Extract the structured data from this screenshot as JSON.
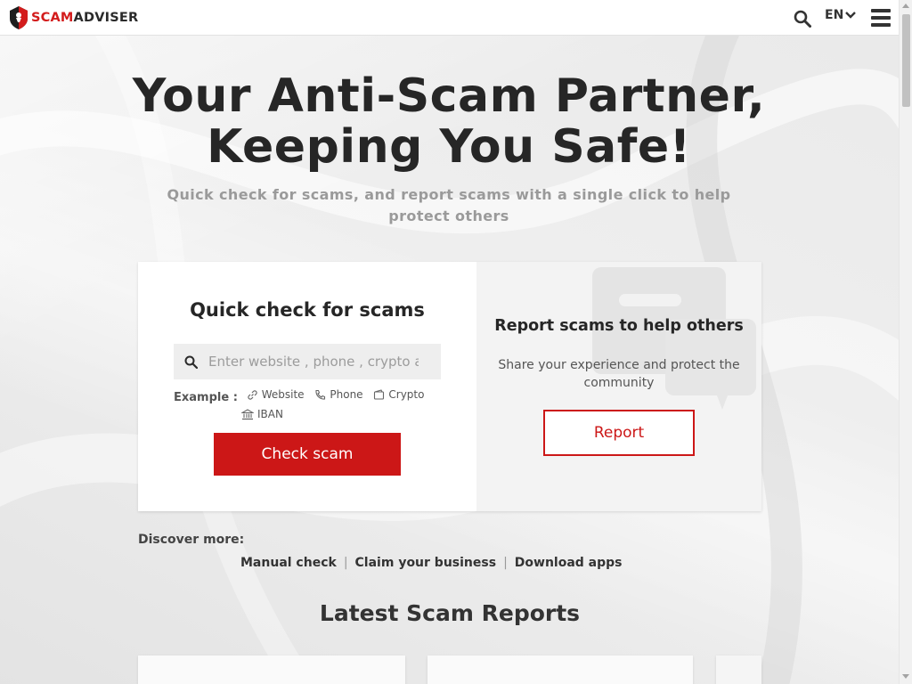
{
  "header": {
    "logo": {
      "part1": "SCAM",
      "part2": "ADVISER"
    },
    "lang": "EN",
    "icons": {
      "search": "search-icon",
      "language_caret": "chevron-down-icon",
      "menu": "hamburger-menu-icon"
    }
  },
  "hero": {
    "title_line1": "Your Anti-Scam Partner,",
    "title_line2": "Keeping You Safe!",
    "subtitle": "Quick check for scams, and report scams with a single click to help protect others"
  },
  "quick_check": {
    "title": "Quick check for scams",
    "placeholder": "Enter website , phone , crypto address or IBAN",
    "example_label": "Example :",
    "examples": [
      "Website",
      "Phone",
      "Crypto",
      "IBAN"
    ],
    "button": "Check scam"
  },
  "report": {
    "title": "Report scams to help others",
    "subtitle": "Share your experience and protect the community",
    "button": "Report"
  },
  "discover": {
    "label": "Discover more:",
    "links": [
      "Manual check",
      "Claim your business",
      "Download apps"
    ]
  },
  "latest": {
    "title": "Latest Scam Reports"
  },
  "colors": {
    "brand_red": "#cc1717",
    "text_dark": "#262626",
    "subtitle_gray": "#9a9a9a"
  }
}
